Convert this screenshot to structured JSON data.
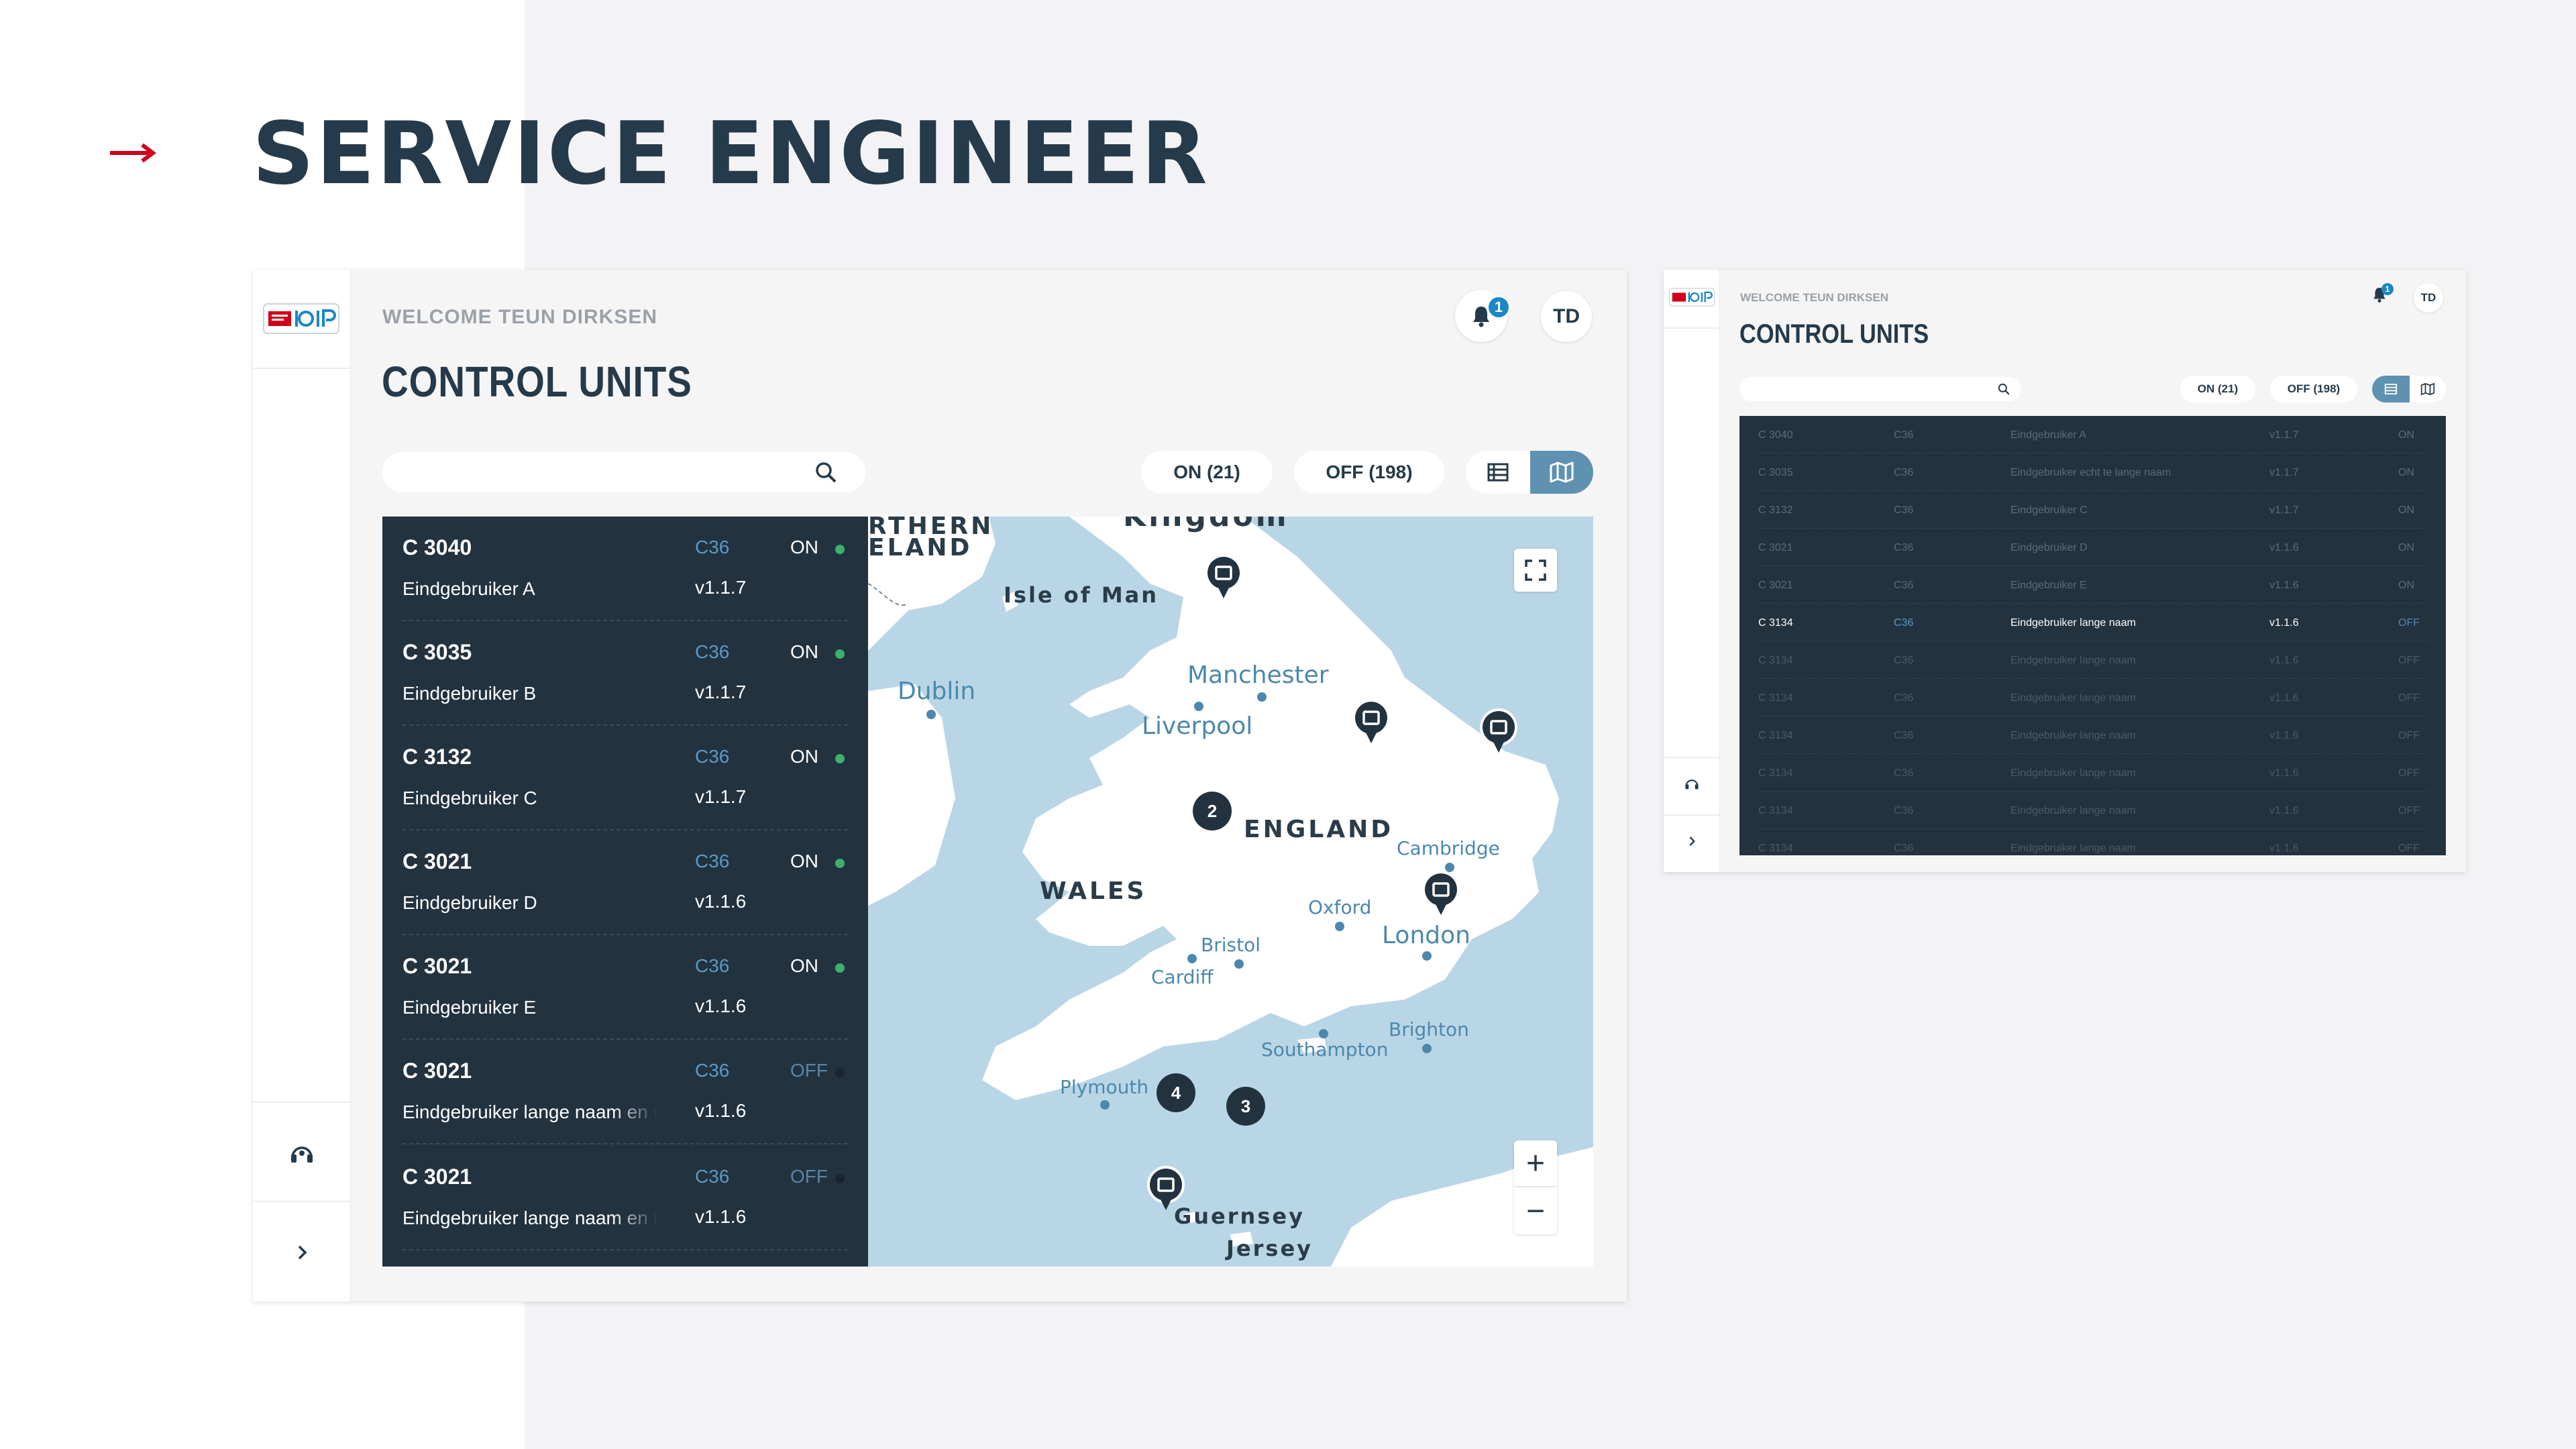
{
  "hero": {
    "title": "SERVICE ENGINEER"
  },
  "colors": {
    "accent_red": "#d0021b",
    "navy": "#22323f",
    "title": "#253a4a",
    "blue": "#1b87c5",
    "on_green": "#3bb16d",
    "toggle_active": "#5f91b1"
  },
  "header": {
    "welcome": "WELCOME TEUN DIRKSEN",
    "title": "CONTROL UNITS",
    "notifications": "1",
    "avatar": "TD"
  },
  "filters": {
    "on": "ON (21)",
    "off": "OFF (198)",
    "search_placeholder": ""
  },
  "view_toggle": {
    "active": "map"
  },
  "units": [
    {
      "id": "C 3040",
      "model": "C36",
      "status": "ON",
      "user": "Eindgebruiker A",
      "version": "v1.1.7"
    },
    {
      "id": "C 3035",
      "model": "C36",
      "status": "ON",
      "user": "Eindgebruiker B",
      "version": "v1.1.7"
    },
    {
      "id": "C 3132",
      "model": "C36",
      "status": "ON",
      "user": "Eindgebruiker C",
      "version": "v1.1.7"
    },
    {
      "id": "C 3021",
      "model": "C36",
      "status": "ON",
      "user": "Eindgebruiker D",
      "version": "v1.1.6"
    },
    {
      "id": "C 3021",
      "model": "C36",
      "status": "ON",
      "user": "Eindgebruiker E",
      "version": "v1.1.6"
    },
    {
      "id": "C 3021",
      "model": "C36",
      "status": "OFF",
      "user": "Eindgebruiker lange naam en te",
      "version": "v1.1.6"
    },
    {
      "id": "C 3021",
      "model": "C36",
      "status": "OFF",
      "user": "Eindgebruiker lange naam en te",
      "version": "v1.1.6"
    }
  ],
  "map": {
    "labels": {
      "northern_ireland_1": "RTHERN",
      "northern_ireland_2": "ELAND",
      "kingdom": "Kingdom",
      "isle_of_man": "Isle of Man",
      "dublin": "Dublin",
      "manchester": "Manchester",
      "liverpool": "Liverpool",
      "england": "ENGLAND",
      "wales": "WALES",
      "cambridge": "Cambridge",
      "oxford": "Oxford",
      "london": "London",
      "bristol": "Bristol",
      "cardiff": "Cardiff",
      "brighton": "Brighton",
      "southampton": "Southampton",
      "plymouth": "Plymouth",
      "guernsey": "Guernsey",
      "jersey": "Jersey"
    },
    "clusters": [
      "2",
      "4",
      "3"
    ],
    "zoom_in": "+",
    "zoom_out": "−"
  },
  "secondary": {
    "welcome": "WELCOME TEUN DIRKSEN",
    "title": "CONTROL UNITS",
    "notifications": "1",
    "avatar": "TD",
    "on": "ON (21)",
    "off": "OFF (198)",
    "rows": [
      {
        "id": "C 3040",
        "model": "C36",
        "user": "Eindgebruiker A",
        "version": "v1.1.7",
        "status": "ON"
      },
      {
        "id": "C 3035",
        "model": "C36",
        "user": "Eindgebruiker  echt te lange naam",
        "version": "v1.1.7",
        "status": "ON"
      },
      {
        "id": "C 3132",
        "model": "C36",
        "user": "Eindgebruiker C",
        "version": "v1.1.7",
        "status": "ON"
      },
      {
        "id": "C 3021",
        "model": "C36",
        "user": "Eindgebruiker D",
        "version": "v1.1.6",
        "status": "ON"
      },
      {
        "id": "C 3021",
        "model": "C36",
        "user": "Eindgebruiker E",
        "version": "v1.1.6",
        "status": "ON"
      },
      {
        "id": "C 3134",
        "model": "C36",
        "user": "Eindgebruiker lange naam",
        "version": "v1.1.6",
        "status": "OFF"
      },
      {
        "id": "C 3134",
        "model": "C36",
        "user": "Eindgebruiker lange naam",
        "version": "v1.1.6",
        "status": "OFF"
      },
      {
        "id": "C 3134",
        "model": "C36",
        "user": "Eindgebruiker lange naam",
        "version": "v1.1.6",
        "status": "OFF"
      },
      {
        "id": "C 3134",
        "model": "C36",
        "user": "Eindgebruiker lange naam",
        "version": "v1.1.6",
        "status": "OFF"
      },
      {
        "id": "C 3134",
        "model": "C36",
        "user": "Eindgebruiker lange naam",
        "version": "v1.1.6",
        "status": "OFF"
      },
      {
        "id": "C 3134",
        "model": "C36",
        "user": "Eindgebruiker lange naam",
        "version": "v1.1.6",
        "status": "OFF"
      },
      {
        "id": "C 3134",
        "model": "C36",
        "user": "Eindgebruiker lange naam",
        "version": "v1.1.6",
        "status": "OFF"
      }
    ]
  }
}
